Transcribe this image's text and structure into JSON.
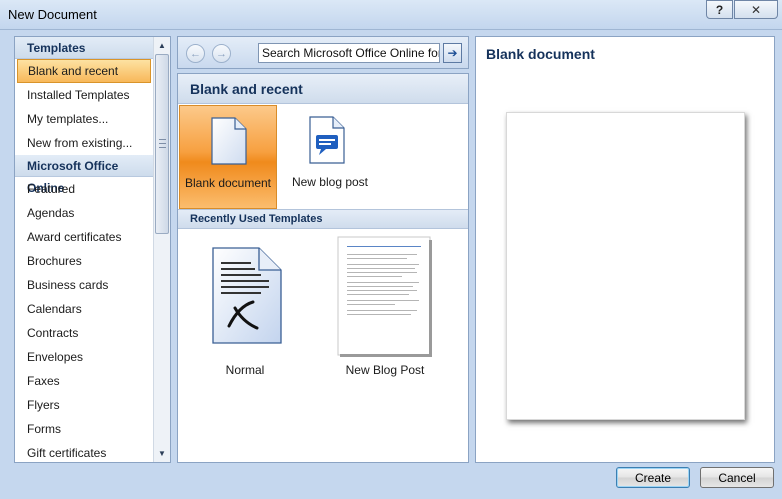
{
  "window": {
    "title": "New Document",
    "help_glyph": "?",
    "close_glyph": "✕"
  },
  "sidebar": {
    "templates_header": "Templates",
    "local_items": [
      {
        "label": "Blank and recent",
        "selected": true
      },
      {
        "label": "Installed Templates"
      },
      {
        "label": "My templates..."
      },
      {
        "label": "New from existing..."
      }
    ],
    "online_header": "Microsoft Office Online",
    "online_items": [
      "Featured",
      "Agendas",
      "Award certificates",
      "Brochures",
      "Business cards",
      "Calendars",
      "Contracts",
      "Envelopes",
      "Faxes",
      "Flyers",
      "Forms",
      "Gift certificates"
    ]
  },
  "search": {
    "value": "Search Microsoft Office Online for"
  },
  "main": {
    "section_title": "Blank and recent",
    "tiles": [
      {
        "label": "Blank document"
      },
      {
        "label": "New blog post"
      }
    ],
    "recent_title": "Recently Used Templates",
    "recent": [
      {
        "label": "Normal"
      },
      {
        "label": "New Blog Post"
      }
    ]
  },
  "preview": {
    "title": "Blank document"
  },
  "footer": {
    "create_label": "Create",
    "cancel_label": "Cancel"
  },
  "colors": {
    "accent_orange": "#f7a040",
    "frame_blue": "#c5d7ee",
    "heading_navy": "#15325b"
  }
}
